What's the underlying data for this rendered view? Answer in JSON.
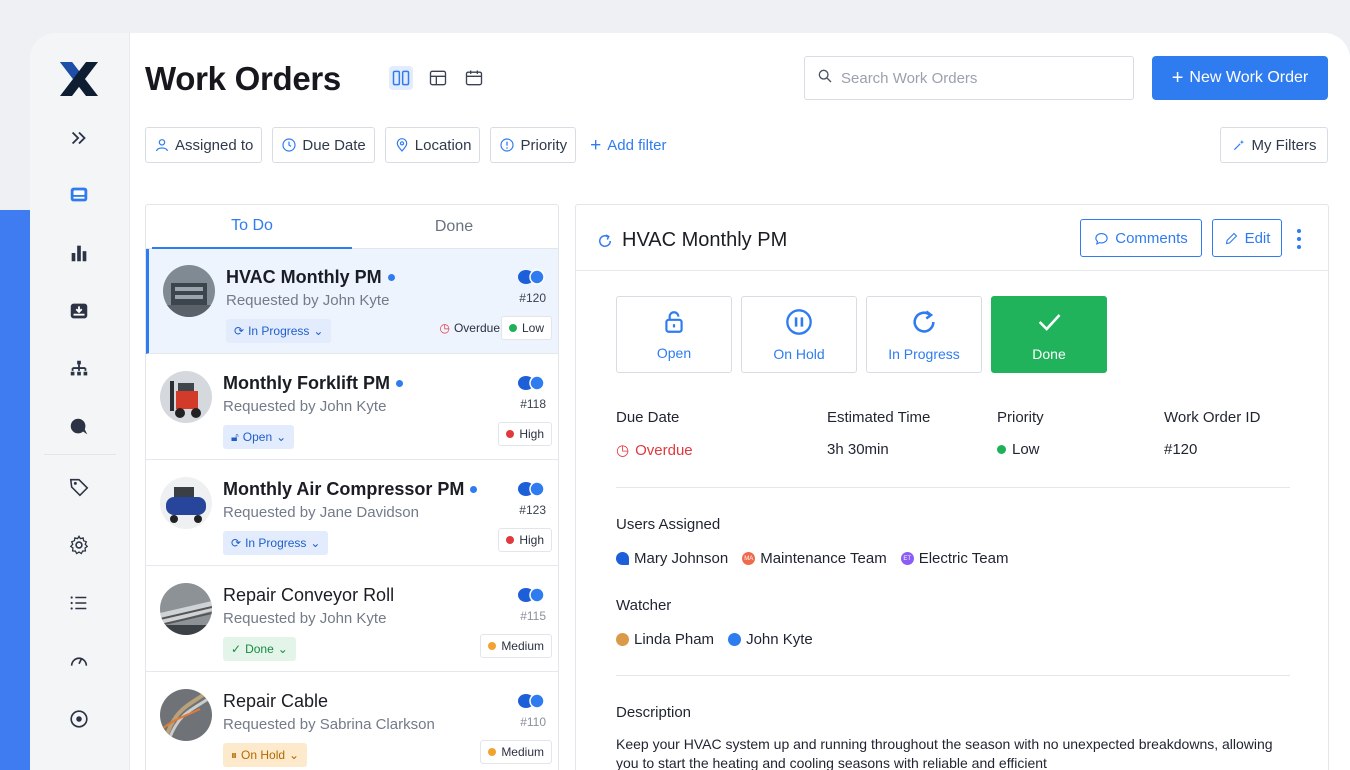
{
  "header": {
    "title": "Work Orders",
    "search_placeholder": "Search Work Orders",
    "new_button": "New Work Order"
  },
  "filters": {
    "chips": [
      "Assigned to",
      "Due Date",
      "Location",
      "Priority"
    ],
    "add_filter": "Add filter",
    "my_filters": "My Filters"
  },
  "list": {
    "tabs": {
      "todo": "To Do",
      "done": "Done"
    },
    "items": [
      {
        "title": "HVAC Monthly PM",
        "requested": "Requested by John Kyte",
        "id": "#120",
        "status": "In Progress",
        "priority": "Low",
        "overdue": "Overdue"
      },
      {
        "title": "Monthly Forklift PM",
        "requested": "Requested by John Kyte",
        "id": "#118",
        "status": "Open",
        "priority": "High"
      },
      {
        "title": "Monthly Air Compressor PM",
        "requested": "Requested by Jane Davidson",
        "id": "#123",
        "status": "In Progress",
        "priority": "High"
      },
      {
        "title": "Repair Conveyor Roll",
        "requested": "Requested by John Kyte",
        "id": "#115",
        "status": "Done",
        "priority": "Medium"
      },
      {
        "title": "Repair Cable",
        "requested": "Requested by Sabrina Clarkson",
        "id": "#110",
        "status": "On Hold",
        "priority": "Medium"
      }
    ]
  },
  "detail": {
    "title": "HVAC Monthly PM",
    "comments_button": "Comments",
    "edit_button": "Edit",
    "status_buttons": [
      "Open",
      "On Hold",
      "In Progress",
      "Done"
    ],
    "fields": {
      "due_date_label": "Due Date",
      "due_date_value": "Overdue",
      "est_time_label": "Estimated Time",
      "est_time_value": "3h 30min",
      "priority_label": "Priority",
      "priority_value": "Low",
      "wo_id_label": "Work Order ID",
      "wo_id_value": "#120"
    },
    "users_label": "Users Assigned",
    "users": [
      "Mary Johnson",
      "Maintenance Team",
      "Electric Team"
    ],
    "user_initials": [
      "",
      "MA",
      "ET"
    ],
    "watcher_label": "Watcher",
    "watchers": [
      "Linda Pham",
      "John Kyte"
    ],
    "description_label": "Description",
    "description": "Keep your HVAC system up and running throughout the season with no unexpected breakdowns, allowing you to start the heating and cooling seasons with reliable and efficient"
  },
  "colors": {
    "accent": "#2f7cf0",
    "done_green": "#20b35c",
    "overdue_red": "#e0393e",
    "low_green": "#1fb15a",
    "high_red": "#e0393e",
    "medium_orange": "#f3a22f"
  }
}
